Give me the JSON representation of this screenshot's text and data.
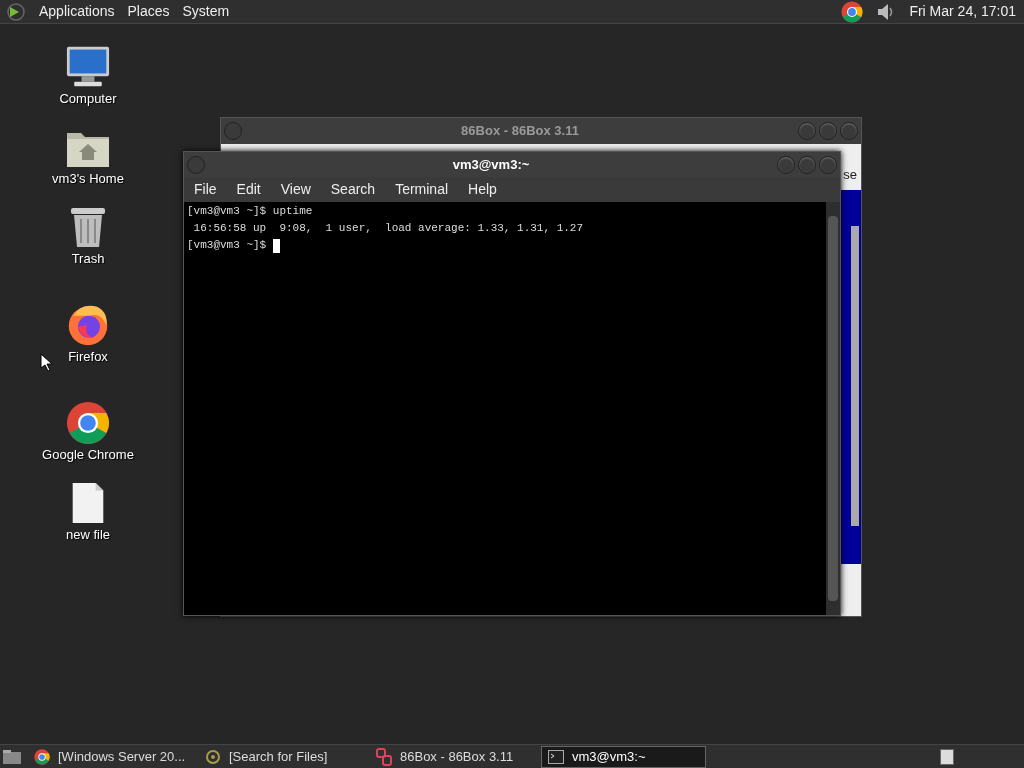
{
  "top_panel": {
    "menus": [
      "Applications",
      "Places",
      "System"
    ],
    "clock": "Fri Mar 24, 17:01"
  },
  "desktop_icons": [
    {
      "kind": "computer",
      "label": "Computer"
    },
    {
      "kind": "home",
      "label": "vm3's Home"
    },
    {
      "kind": "trash",
      "label": "Trash"
    },
    {
      "kind": "firefox",
      "label": "Firefox"
    },
    {
      "kind": "chrome",
      "label": "Google Chrome"
    },
    {
      "kind": "file",
      "label": "new file"
    }
  ],
  "back_window": {
    "title": "86Box - 86Box 3.11",
    "toolbar_text": "se"
  },
  "terminal_window": {
    "title": "vm3@vm3:~",
    "menus": [
      "File",
      "Edit",
      "View",
      "Search",
      "Terminal",
      "Help"
    ],
    "lines": [
      "[vm3@vm3 ~]$ uptime",
      " 16:56:58 up  9:08,  1 user,  load average: 1.33, 1.31, 1.27"
    ],
    "prompt": "[vm3@vm3 ~]$ "
  },
  "taskbar": {
    "items": [
      {
        "kind": "chrome",
        "label": "[Windows Server 20...",
        "selected": false
      },
      {
        "kind": "search",
        "label": "[Search for Files]",
        "selected": false
      },
      {
        "kind": "box",
        "label": "86Box - 86Box 3.11",
        "selected": false
      },
      {
        "kind": "terminal",
        "label": "vm3@vm3:~",
        "selected": true
      }
    ]
  }
}
